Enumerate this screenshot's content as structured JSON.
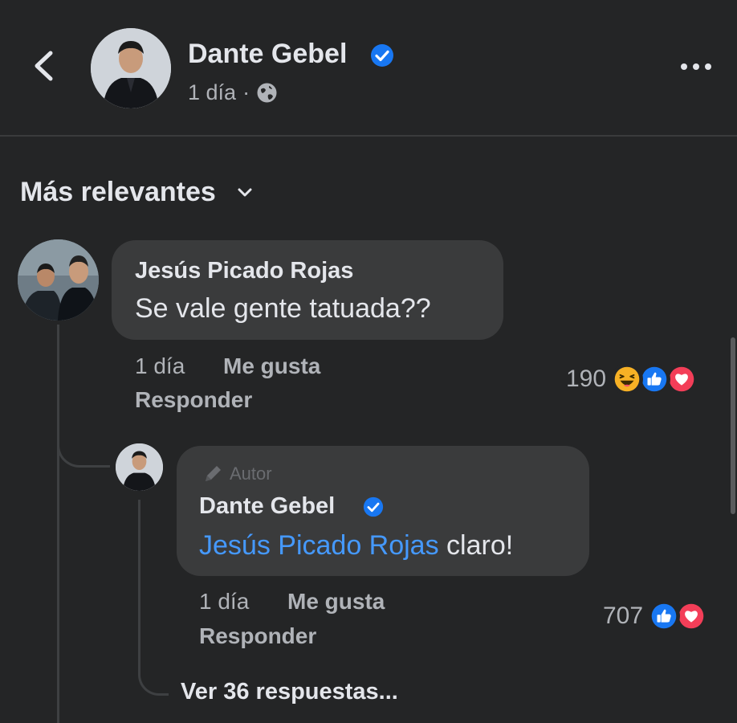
{
  "post": {
    "author_name": "Dante Gebel",
    "time": "1 día",
    "separator": "·",
    "privacy_icon": "globe-icon",
    "verified_icon": "verified-badge-icon",
    "more_icon": "more-horizontal-icon",
    "back_icon": "chevron-left-icon"
  },
  "sort": {
    "label": "Más relevantes",
    "icon": "chevron-down-icon"
  },
  "comments": [
    {
      "author": "Jesús Picado Rojas",
      "text": "Se vale gente tatuada??",
      "time": "1 día",
      "like_label": "Me gusta",
      "reply_label": "Responder",
      "reaction_count": "190",
      "reactions": [
        "haha-reaction-icon",
        "like-reaction-icon",
        "love-reaction-icon"
      ],
      "reply": {
        "badge_label": "Autor",
        "author": "Dante Gebel",
        "mention": "Jesús Picado Rojas",
        "text": " claro!",
        "time": "1 día",
        "like_label": "Me gusta",
        "reply_label": "Responder",
        "reaction_count": "707",
        "reactions": [
          "like-reaction-icon",
          "love-reaction-icon"
        ]
      },
      "view_replies_label": "Ver 36 respuestas..."
    }
  ],
  "colors": {
    "background": "#242526",
    "bubble": "#3a3b3c",
    "mention": "#4599ff",
    "verified": "#1877f2",
    "love": "#f33e58",
    "haha": "#f7b125"
  }
}
